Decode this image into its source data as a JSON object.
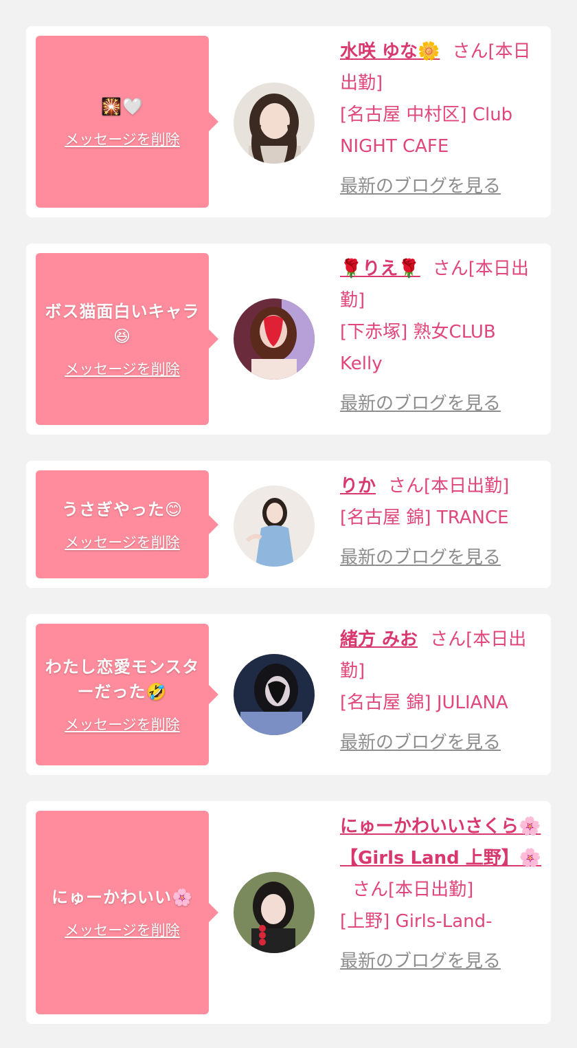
{
  "delete_label": "メッセージを削除",
  "blog_label": "最新のブログを見る",
  "san_prefix": "さん[本日出勤]",
  "colors": {
    "background": "#f2f2f2",
    "bubble": "#ff8c9c",
    "name": "#d8386e",
    "text": "#e0467a",
    "link_gray": "#8d8d8d"
  },
  "cards": [
    {
      "message": "🎇🤍",
      "name": "水咲 ゆな🌼",
      "san": "さん[本日出勤]",
      "shop": "[名古屋 中村区] Club NIGHT CAFE",
      "avatar_icon": "girl-photo-avatar"
    },
    {
      "message": "ボス猫面白いキャラ😆",
      "name": "🌹りえ🌹",
      "san": "さん[本日出勤]",
      "shop": "[下赤塚] 熟女CLUB Kelly",
      "avatar_icon": "girl-photo-avatar"
    },
    {
      "message": "うさぎやった😊",
      "name": "りか",
      "san": "さん[本日出勤]",
      "shop": "[名古屋 錦] TRANCE",
      "avatar_icon": "girl-photo-avatar"
    },
    {
      "message": "わたし恋愛モンスターだった🤣",
      "name": "緒方 みお",
      "san": "さん[本日出勤]",
      "shop": "[名古屋 錦] JULIANA",
      "avatar_icon": "girl-photo-avatar"
    },
    {
      "message": "にゅーかわいい🌸",
      "name": "にゅーかわいいさくら🌸【Girls Land 上野】🌸",
      "san": "さん[本日出勤]",
      "shop": "[上野] Girls-Land-",
      "avatar_icon": "girl-photo-avatar"
    }
  ]
}
